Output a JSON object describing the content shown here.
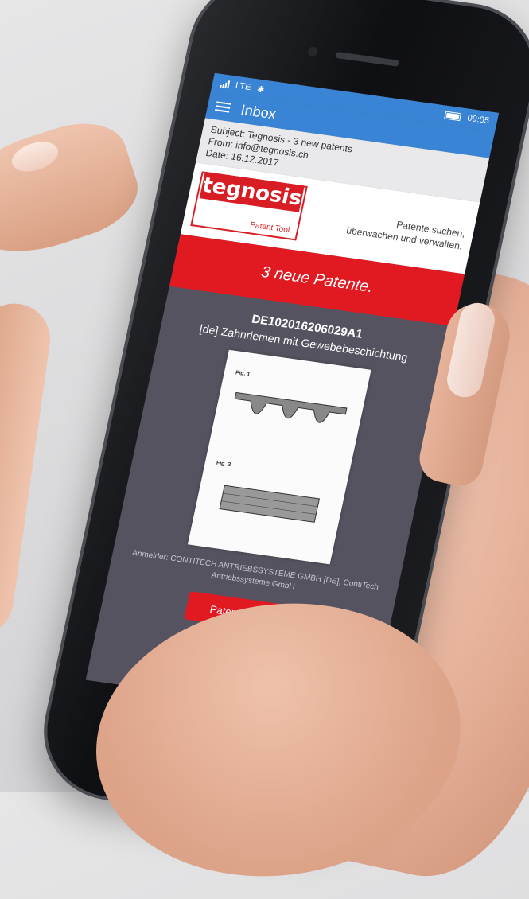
{
  "statusbar": {
    "carrier": "LTE",
    "bluetooth_icon": "bluetooth-icon",
    "time": "09:05"
  },
  "navbar": {
    "title": "Inbox",
    "menu_icon": "hamburger-menu-icon"
  },
  "mail": {
    "subject": "Subject: Tegnosis - 3 new patents",
    "from": "From: info@tegnosis.ch",
    "date": "Date: 16.12.2017"
  },
  "brand": {
    "logo_word": "tegnosis",
    "logo_sub": "Patent Tool.",
    "tagline_line1": "Patente suchen,",
    "tagline_line2": "überwachen und verwalten."
  },
  "banner": {
    "text": "3 neue Patente."
  },
  "patent": {
    "id": "DE102016206029A1",
    "title": "[de] Zahnriemen mit Gewebebeschichtung",
    "drawing_fig1": "Fig. 1",
    "drawing_fig2": "Fig. 2",
    "applicant": "Anmelder: CONTITECH ANTRIEBSSYSTEME GMBH [DE], ContiTech Antriebssysteme GmbH",
    "cta_label": "Patent ansehen"
  },
  "colors": {
    "navbar": "#3a84d6",
    "brand_red": "#e11a22",
    "screen_bg": "#54535f"
  }
}
